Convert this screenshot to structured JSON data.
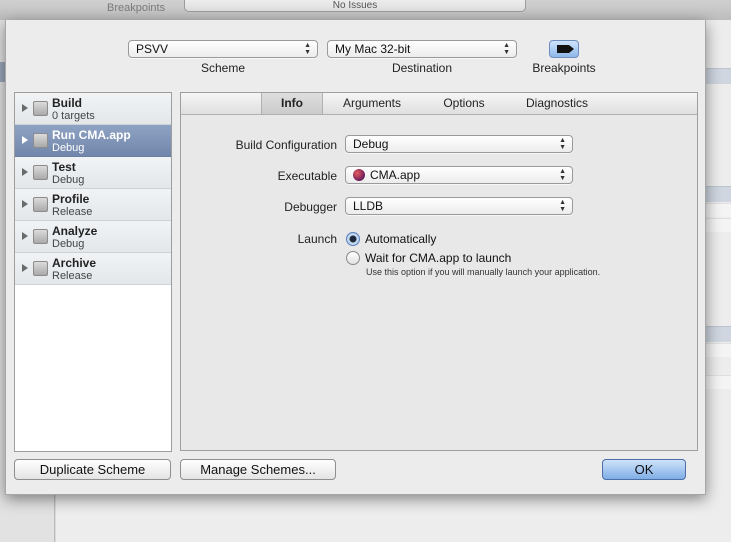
{
  "background": {
    "breakpoints_label": "Breakpoints",
    "issues_text": "No Issues"
  },
  "toolbar": {
    "scheme_value": "PSVV",
    "scheme_caption": "Scheme",
    "destination_value": "My Mac 32-bit",
    "destination_caption": "Destination",
    "breakpoints_caption": "Breakpoints",
    "breakpoints_icon": "breakpoint-arrow-icon"
  },
  "actions": [
    {
      "name": "Build",
      "sub": "0 targets",
      "selected": false
    },
    {
      "name": "Run CMA.app",
      "sub": "Debug",
      "selected": true
    },
    {
      "name": "Test",
      "sub": "Debug",
      "selected": false
    },
    {
      "name": "Profile",
      "sub": "Release",
      "selected": false
    },
    {
      "name": "Analyze",
      "sub": "Debug",
      "selected": false
    },
    {
      "name": "Archive",
      "sub": "Release",
      "selected": false
    }
  ],
  "tabs": [
    {
      "label": "Info",
      "active": true
    },
    {
      "label": "Arguments",
      "active": false
    },
    {
      "label": "Options",
      "active": false
    },
    {
      "label": "Diagnostics",
      "active": false
    }
  ],
  "info": {
    "build_config_label": "Build Configuration",
    "build_config_value": "Debug",
    "executable_label": "Executable",
    "executable_value": "CMA.app",
    "debugger_label": "Debugger",
    "debugger_value": "LLDB",
    "launch_label": "Launch",
    "launch_auto": "Automatically",
    "launch_wait": "Wait for CMA.app to launch",
    "launch_wait_note": "Use this option if you will manually launch your application.",
    "launch_selected": "auto"
  },
  "buttons": {
    "duplicate": "Duplicate Scheme",
    "manage": "Manage Schemes...",
    "ok": "OK"
  },
  "colors": {
    "selection": "#7f93b5",
    "default_button": "#8fb7ea"
  }
}
